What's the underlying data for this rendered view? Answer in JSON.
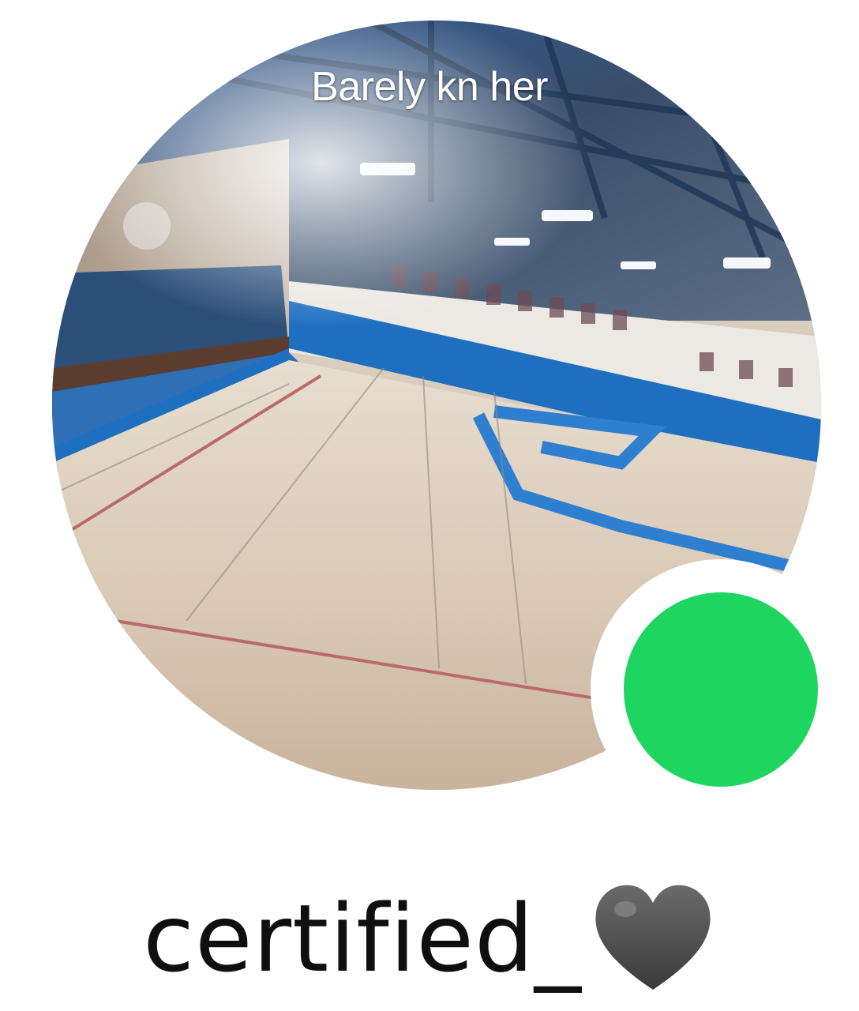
{
  "profile": {
    "caption": "Barely kn her",
    "username": "certified_",
    "username_emoji": "black-heart-icon",
    "status": "online",
    "status_color": "#1ed65f",
    "avatar_subject": "indoor gymnasium court photo"
  }
}
